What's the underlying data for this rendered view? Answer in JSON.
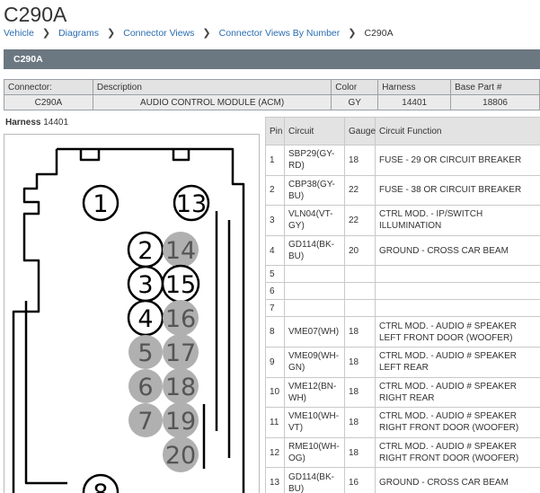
{
  "page_title": "C290A",
  "breadcrumb": [
    "Vehicle",
    "Diagrams",
    "Connector Views",
    "Connector Views By Number",
    "C290A"
  ],
  "section_header": "C290A",
  "info": {
    "headers": [
      "Connector:",
      "Description",
      "Color",
      "Harness",
      "Base Part #"
    ],
    "values": [
      "C290A",
      "AUDIO CONTROL MODULE (ACM)",
      "GY",
      "14401",
      "18806"
    ]
  },
  "harness": {
    "label": "Harness",
    "number": "14401"
  },
  "pin_table": {
    "headers": [
      "Pin",
      "Circuit",
      "Gauge",
      "Circuit Function"
    ],
    "rows": [
      {
        "pin": "1",
        "circuit": "SBP29(GY-RD)",
        "gauge": "18",
        "function": "FUSE - 29 OR CIRCUIT BREAKER"
      },
      {
        "pin": "2",
        "circuit": "CBP38(GY-BU)",
        "gauge": "22",
        "function": "FUSE - 38 OR CIRCUIT BREAKER"
      },
      {
        "pin": "3",
        "circuit": "VLN04(VT-GY)",
        "gauge": "22",
        "function": "CTRL MOD. - IP/SWITCH ILLUMINATION"
      },
      {
        "pin": "4",
        "circuit": "GD114(BK-BU)",
        "gauge": "20",
        "function": "GROUND - CROSS CAR BEAM"
      },
      {
        "pin": "5",
        "circuit": "",
        "gauge": "",
        "function": ""
      },
      {
        "pin": "6",
        "circuit": "",
        "gauge": "",
        "function": ""
      },
      {
        "pin": "7",
        "circuit": "",
        "gauge": "",
        "function": ""
      },
      {
        "pin": "8",
        "circuit": "VME07(WH)",
        "gauge": "18",
        "function": "CTRL MOD. - AUDIO # SPEAKER LEFT FRONT DOOR (WOOFER)"
      },
      {
        "pin": "9",
        "circuit": "VME09(WH-GN)",
        "gauge": "18",
        "function": "CTRL MOD. - AUDIO # SPEAKER LEFT REAR"
      },
      {
        "pin": "10",
        "circuit": "VME12(BN-WH)",
        "gauge": "18",
        "function": "CTRL MOD. - AUDIO # SPEAKER RIGHT REAR"
      },
      {
        "pin": "11",
        "circuit": "VME10(WH-VT)",
        "gauge": "18",
        "function": "CTRL MOD. - AUDIO # SPEAKER RIGHT FRONT DOOR (WOOFER)"
      },
      {
        "pin": "12",
        "circuit": "RME10(WH-OG)",
        "gauge": "18",
        "function": "CTRL MOD. - AUDIO # SPEAKER RIGHT FRONT DOOR (WOOFER)"
      },
      {
        "pin": "13",
        "circuit": "GD114(BK-BU)",
        "gauge": "16",
        "function": "GROUND - CROSS CAR BEAM"
      }
    ]
  },
  "diagram_pins": [
    {
      "label": "1",
      "filled": false
    },
    {
      "label": "13",
      "filled": false
    },
    {
      "label": "2",
      "filled": false
    },
    {
      "label": "14",
      "filled": true
    },
    {
      "label": "3",
      "filled": false
    },
    {
      "label": "15",
      "filled": false
    },
    {
      "label": "4",
      "filled": false
    },
    {
      "label": "16",
      "filled": true
    },
    {
      "label": "5",
      "filled": true
    },
    {
      "label": "17",
      "filled": true
    },
    {
      "label": "6",
      "filled": true
    },
    {
      "label": "18",
      "filled": true
    },
    {
      "label": "7",
      "filled": true
    },
    {
      "label": "19",
      "filled": true
    },
    {
      "label": "20",
      "filled": true
    },
    {
      "label": "8",
      "filled": false
    }
  ],
  "colors": {
    "link": "#2a6db0",
    "section_bar": "#6b7781",
    "filled_pin": "#b0b0b0"
  }
}
